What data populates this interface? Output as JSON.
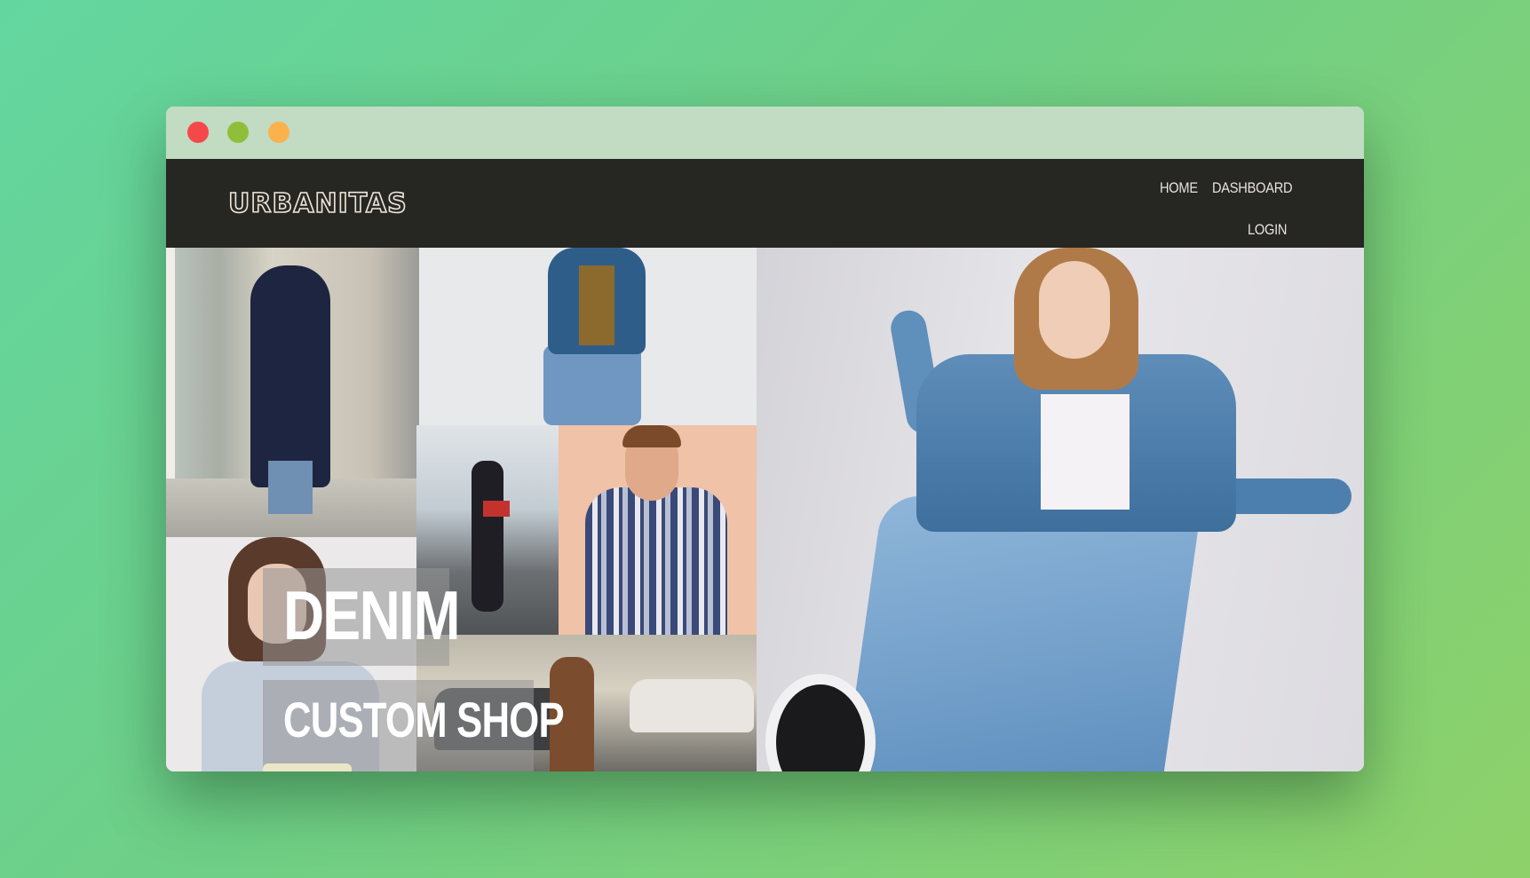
{
  "window": {
    "controls": [
      "close",
      "minimize",
      "maximize"
    ],
    "colors": {
      "close": "#f5484b",
      "minimize": "#8fbf3a",
      "maximize": "#fbb24d",
      "titlebar": "#c1dcc3"
    }
  },
  "navbar": {
    "logo": "URBANITAS",
    "links": {
      "home": "HOME",
      "dashboard": "DASHBOARD",
      "login": "LOGIN"
    },
    "background": "#262623"
  },
  "hero": {
    "title": "DENIM",
    "subtitle": "CUSTOM SHOP",
    "images": [
      "woman-navy-coat-photo",
      "man-denim-jacket-photo",
      "woman-portrait-photo",
      "woman-street-red-bag-photo",
      "man-plaid-shirt-photo",
      "woman-street-cars-photo",
      "woman-denim-jacket-kick-photo"
    ]
  }
}
